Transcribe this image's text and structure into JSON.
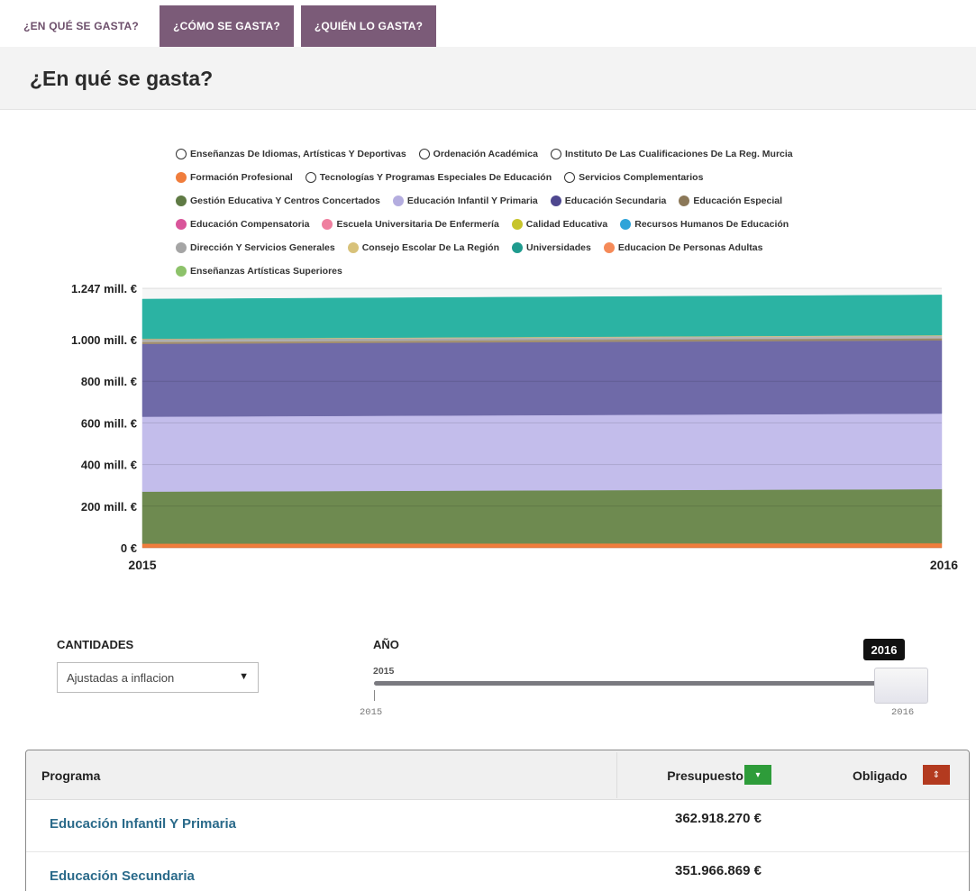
{
  "tabs": [
    {
      "label": "¿En qué se gasta?"
    },
    {
      "label": "¿Cómo se gasta?"
    },
    {
      "label": "¿Quién lo gasta?"
    }
  ],
  "page_title": "¿En qué se gasta?",
  "legend": [
    [
      {
        "label": "Enseñanzas De Idiomas, Artísticas Y Deportivas",
        "color": "#ffffff",
        "hollow": true
      },
      {
        "label": "Ordenación Académica",
        "color": "#ffffff",
        "hollow": true
      },
      {
        "label": "Instituto De Las Cualificaciones De La Reg. Murcia",
        "color": "#ffffff",
        "hollow": true
      }
    ],
    [
      {
        "label": "Formación Profesional",
        "color": "#f07d3c"
      },
      {
        "label": "Tecnologías Y Programas Especiales De Educación",
        "color": "#ffffff",
        "hollow": true
      },
      {
        "label": "Servicios Complementarios",
        "color": "#ffffff",
        "hollow": true
      }
    ],
    [
      {
        "label": "Gestión Educativa Y Centros Concertados",
        "color": "#5f7a44"
      },
      {
        "label": "Educación Infantil Y Primaria",
        "color": "#b4addf"
      },
      {
        "label": "Educación Secundaria",
        "color": "#4e478f"
      },
      {
        "label": "Educación Especial",
        "color": "#8b7858"
      }
    ],
    [
      {
        "label": "Educación Compensatoria",
        "color": "#d9559a"
      },
      {
        "label": "Escuela Universitaria De Enfermería",
        "color": "#ef7f9f"
      },
      {
        "label": "Calidad Educativa",
        "color": "#c7c42b"
      },
      {
        "label": "Recursos Humanos De Educación",
        "color": "#2fa4d9"
      }
    ],
    [
      {
        "label": "Dirección Y Servicios Generales",
        "color": "#a5a5a5"
      },
      {
        "label": "Consejo Escolar De La Región",
        "color": "#d8c27a"
      },
      {
        "label": "Universidades",
        "color": "#1f9b8e"
      },
      {
        "label": "Educacion De Personas Adultas",
        "color": "#f58a58"
      }
    ],
    [
      {
        "label": "Enseñanzas Artísticas Superiores",
        "color": "#8dc26a"
      }
    ]
  ],
  "chart_data": {
    "type": "area",
    "stacked": true,
    "x": [
      "2015",
      "2016"
    ],
    "ylim": [
      0,
      1247
    ],
    "y_ticks": [
      "0 €",
      "200 mill. €",
      "400 mill. €",
      "600 mill. €",
      "800 mill. €",
      "1.000 mill. €",
      "1.247 mill. €"
    ],
    "y_tick_values": [
      0,
      200,
      400,
      600,
      800,
      1000,
      1247
    ],
    "series": [
      {
        "name": "Formación Profesional",
        "color": "#f07d3c",
        "values": [
          20,
          22
        ]
      },
      {
        "name": "Gestión Educativa Y Centros Concertados",
        "color": "#6e8a50",
        "values": [
          250,
          260
        ]
      },
      {
        "name": "Educación Infantil Y Primaria",
        "color": "#c3bdeb",
        "values": [
          360,
          363
        ]
      },
      {
        "name": "Educación Secundaria",
        "color": "#6f6aa8",
        "values": [
          350,
          352
        ]
      },
      {
        "name": "Educación Especial",
        "color": "#a39070",
        "values": [
          10,
          10
        ]
      },
      {
        "name": "Dirección Y Servicios Generales",
        "color": "#b5b5b5",
        "values": [
          12,
          12
        ]
      },
      {
        "name": "Consejo Escolar De La Región",
        "color": "#d8c27a",
        "values": [
          3,
          3
        ]
      },
      {
        "name": "Universidades",
        "color": "#2bb3a3",
        "values": [
          190,
          193
        ]
      }
    ]
  },
  "controls": {
    "cantidades_label": "CANTIDADES",
    "cantidades_value": "Ajustadas a inflacion",
    "ano_label": "AÑO",
    "slider_min_label": "2015",
    "slider_value": "2016",
    "slider_axis_min": "2015",
    "slider_axis_max": "2016"
  },
  "table": {
    "col_programa": "Programa",
    "col_presupuesto": "Presupuesto",
    "col_obligado": "Obligado",
    "rows": [
      {
        "programa": "Educación Infantil Y Primaria",
        "presupuesto": "362.918.270 €"
      },
      {
        "programa": "Educación Secundaria",
        "presupuesto": "351.966.869 €"
      }
    ]
  }
}
